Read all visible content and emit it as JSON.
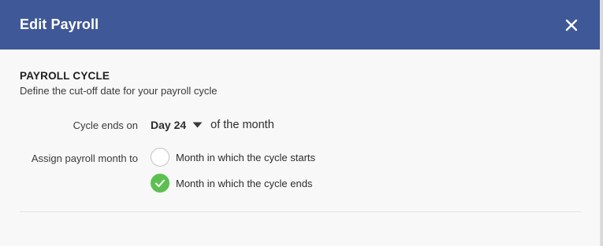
{
  "modal": {
    "title": "Edit Payroll",
    "close_label": "×"
  },
  "section": {
    "title": "PAYROLL CYCLE",
    "description": "Define the cut-off date for your payroll cycle"
  },
  "cycle": {
    "label": "Cycle ends on",
    "day_value": "Day 24",
    "suffix": "of the month"
  },
  "assign": {
    "label": "Assign payroll month to",
    "options": [
      {
        "label": "Month in which the cycle starts",
        "selected": false
      },
      {
        "label": "Month in which the cycle ends",
        "selected": true
      }
    ]
  },
  "colors": {
    "header_bg": "#3f5897",
    "checked": "#5cc050"
  },
  "icons": {
    "close": "close-icon",
    "dropdown": "caret-down-icon",
    "check": "check-icon"
  }
}
